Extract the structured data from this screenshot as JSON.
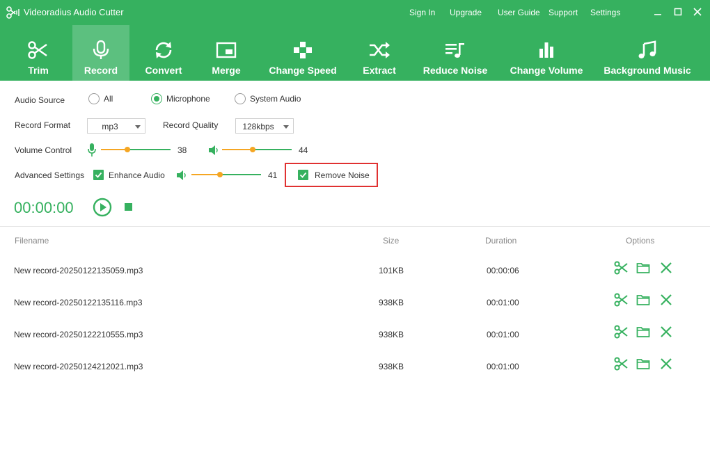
{
  "app": {
    "title": "Videoradius Audio Cutter"
  },
  "top_links": [
    "Sign In",
    "Upgrade",
    "User Guide",
    "Support",
    "Settings"
  ],
  "toolbar": [
    {
      "label": "Trim",
      "icon": "scissors-icon"
    },
    {
      "label": "Record",
      "icon": "microphone-icon",
      "active": true
    },
    {
      "label": "Convert",
      "icon": "convert-icon"
    },
    {
      "label": "Merge",
      "icon": "merge-icon"
    },
    {
      "label": "Change Speed",
      "icon": "gamepad-icon"
    },
    {
      "label": "Extract",
      "icon": "shuffle-icon"
    },
    {
      "label": "Reduce Noise",
      "icon": "noise-icon"
    },
    {
      "label": "Change Volume",
      "icon": "bars-icon"
    },
    {
      "label": "Background Music",
      "icon": "music-note-icon"
    }
  ],
  "settings": {
    "audio_source_label": "Audio Source",
    "audio_source_options": [
      "All",
      "Microphone",
      "System Audio"
    ],
    "audio_source_selected": "Microphone",
    "record_format_label": "Record Format",
    "record_format_value": "mp3",
    "record_quality_label": "Record Quality",
    "record_quality_value": "128kbps",
    "volume_control_label": "Volume Control",
    "mic_volume": 38,
    "system_volume": 44,
    "advanced_label": "Advanced Settings",
    "enhance_audio_label": "Enhance Audio",
    "enhance_audio_checked": true,
    "enhance_volume": 41,
    "remove_noise_label": "Remove Noise",
    "remove_noise_checked": true
  },
  "timer": "00:00:00",
  "table": {
    "headers": {
      "filename": "Filename",
      "size": "Size",
      "duration": "Duration",
      "options": "Options"
    },
    "rows": [
      {
        "filename": "New record-20250122135059.mp3",
        "size": "101KB",
        "duration": "00:00:06"
      },
      {
        "filename": "New record-20250122135116.mp3",
        "size": "938KB",
        "duration": "00:01:00"
      },
      {
        "filename": "New record-20250122210555.mp3",
        "size": "938KB",
        "duration": "00:01:00"
      },
      {
        "filename": "New record-20250124212021.mp3",
        "size": "938KB",
        "duration": "00:01:00"
      }
    ]
  },
  "colors": {
    "brand": "#36b15f",
    "active_tab": "#5cc07f",
    "slider_fill": "#f5a623",
    "highlight": "#e03131"
  }
}
